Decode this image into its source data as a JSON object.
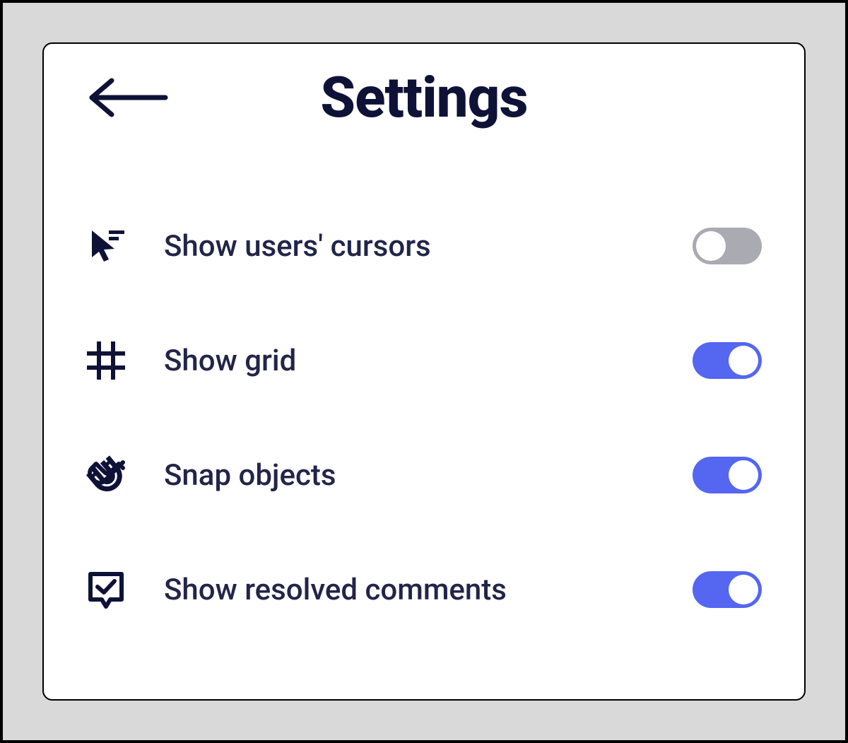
{
  "title": "Settings",
  "options": [
    {
      "id": "show-cursors",
      "icon": "cursor-icon",
      "label": "Show users' cursors",
      "on": false
    },
    {
      "id": "show-grid",
      "icon": "grid-icon",
      "label": "Show grid",
      "on": true
    },
    {
      "id": "snap-objects",
      "icon": "magnet-icon",
      "label": "Snap objects",
      "on": true
    },
    {
      "id": "show-resolved-comments",
      "icon": "comment-check-icon",
      "label": "Show resolved comments",
      "on": true
    }
  ],
  "colors": {
    "text": "#0f1237",
    "toggle_on": "#5566f1",
    "toggle_off": "#a9aab2"
  }
}
